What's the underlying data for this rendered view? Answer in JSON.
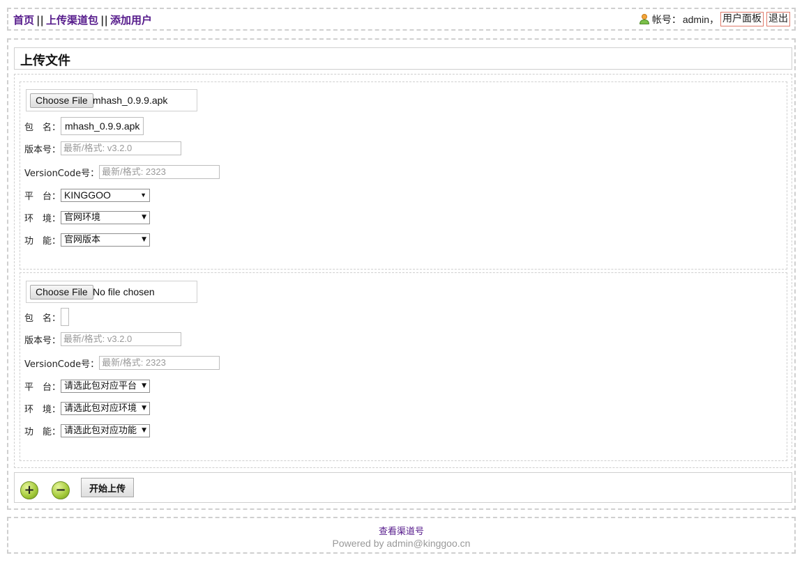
{
  "header": {
    "nav": [
      {
        "label": "首页"
      },
      {
        "label": "上传渠道包"
      },
      {
        "label": "添加用户"
      }
    ],
    "separator": "||",
    "account_label": "帐号：",
    "username": "admin",
    "comma": "，",
    "user_panel": "用户面板",
    "logout": "退出"
  },
  "main": {
    "title": "上传文件",
    "files": [
      {
        "choose_label": "Choose File",
        "file_status": "mhash_0.9.9.apk",
        "package_label": "包　名：",
        "package_value": "mhash_0.9.9.apk",
        "version_label": "版本号：",
        "version_placeholder": "最新/格式: v3.2.0",
        "versioncode_label": "VersionCode号：",
        "versioncode_placeholder": "最新/格式: 2323",
        "platform_label": "平　台：",
        "platform_value": "KINGGOO",
        "env_label": "环　境：",
        "env_value": "官网环境",
        "feature_label": "功　能：",
        "feature_value": "官网版本"
      },
      {
        "choose_label": "Choose File",
        "file_status": "No file chosen",
        "package_label": "包　名：",
        "package_value": "",
        "version_label": "版本号：",
        "version_placeholder": "最新/格式: v3.2.0",
        "versioncode_label": "VersionCode号：",
        "versioncode_placeholder": "最新/格式: 2323",
        "platform_label": "平　台：",
        "platform_value": "请选此包对应平台",
        "env_label": "环　境：",
        "env_value": "请选此包对应环境",
        "feature_label": "功　能：",
        "feature_value": "请选此包对应功能"
      }
    ],
    "start_upload": "开始上传"
  },
  "footer": {
    "link": "查看渠道号",
    "powered": "Powered by admin@kinggoo.cn"
  },
  "icons": {
    "add": "plus-circle-icon",
    "remove": "minus-circle-icon",
    "user": "user-icon",
    "dropdown": "triangle-down-icon"
  },
  "colors": {
    "link": "#551a8b",
    "border": "#cfcfcf",
    "round_button": "#a3c93a",
    "account_button_border": "#e07a6a"
  }
}
